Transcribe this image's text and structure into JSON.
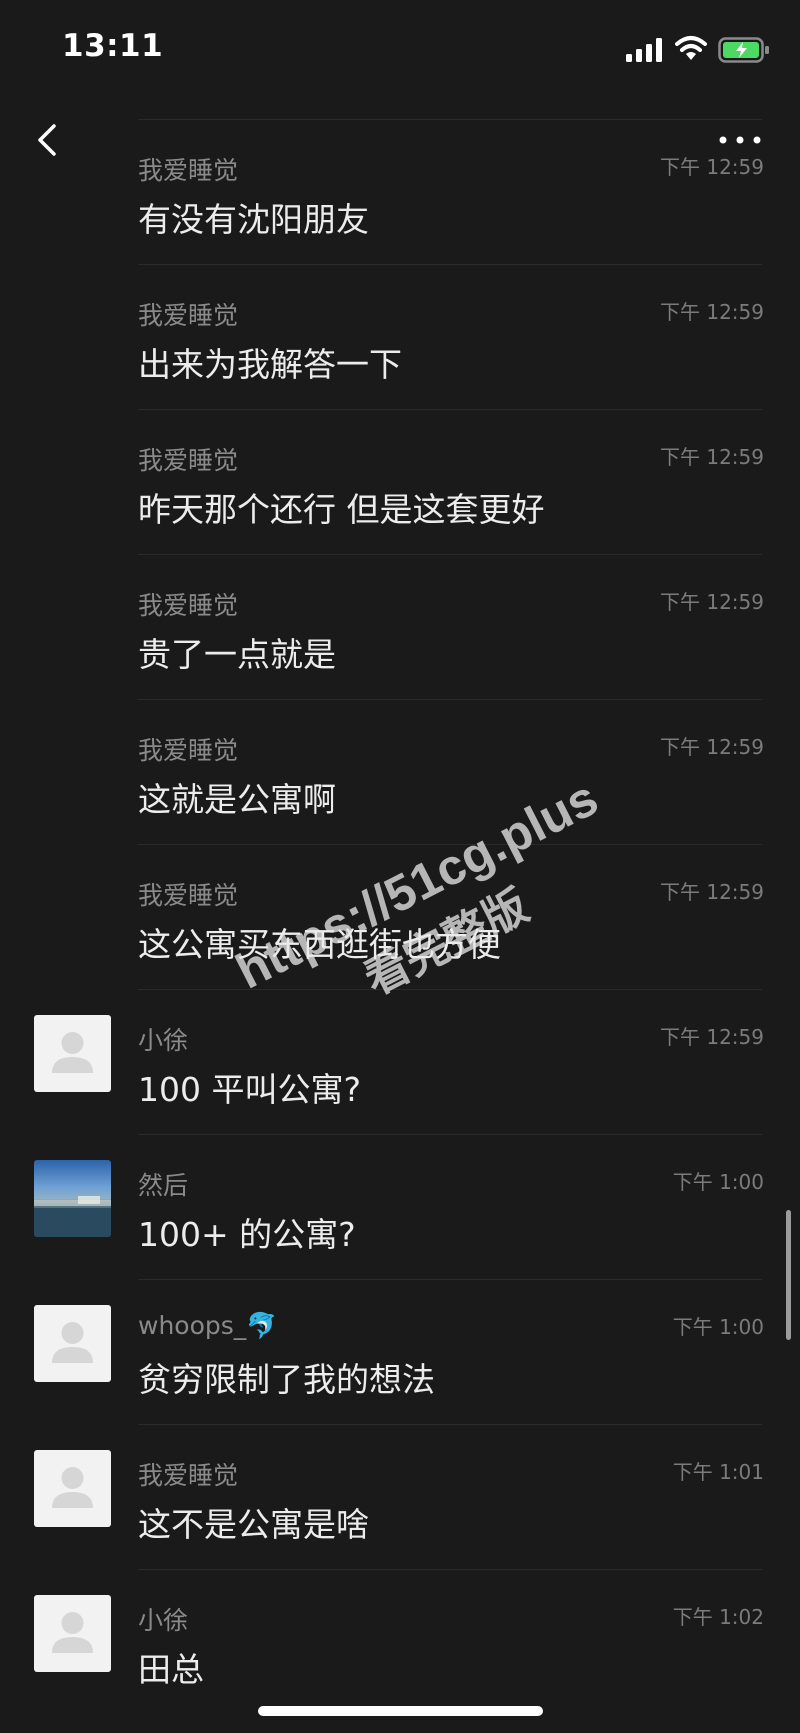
{
  "status_bar": {
    "time": "13:11"
  },
  "messages": [
    {
      "sender": "我爱睡觉",
      "time": "下午 12:59",
      "text": "有没有沈阳朋友",
      "avatar": "none"
    },
    {
      "sender": "我爱睡觉",
      "time": "下午 12:59",
      "text": "出来为我解答一下",
      "avatar": "none"
    },
    {
      "sender": "我爱睡觉",
      "time": "下午 12:59",
      "text": "昨天那个还行 但是这套更好",
      "avatar": "none"
    },
    {
      "sender": "我爱睡觉",
      "time": "下午 12:59",
      "text": "贵了一点就是",
      "avatar": "none"
    },
    {
      "sender": "我爱睡觉",
      "time": "下午 12:59",
      "text": "这就是公寓啊",
      "avatar": "none"
    },
    {
      "sender": "我爱睡觉",
      "time": "下午 12:59",
      "text": "这公寓买东西逛街也方便",
      "avatar": "none"
    },
    {
      "sender": "小徐",
      "time": "下午 12:59",
      "text": "100 平叫公寓?",
      "avatar": "default-avatar"
    },
    {
      "sender": "然后",
      "time": "下午 1:00",
      "text": "100+ 的公寓?",
      "avatar": "photo-avatar"
    },
    {
      "sender": "whoops_🐬",
      "time": "下午 1:00",
      "text": "贫穷限制了我的想法",
      "avatar": "default-avatar"
    },
    {
      "sender": "我爱睡觉",
      "time": "下午 1:01",
      "text": "这不是公寓是啥",
      "avatar": "default-avatar"
    },
    {
      "sender": "小徐",
      "time": "下午 1:02",
      "text": "田总",
      "avatar": "default-avatar"
    }
  ],
  "watermark": {
    "line1": "https://51cg.plus",
    "line2": "看完整版"
  },
  "icons": {
    "back": "chevron-left-icon",
    "more": "ellipsis-icon",
    "signal": "cellular-signal-icon",
    "wifi": "wifi-icon",
    "battery": "battery-charging-icon",
    "avatar_placeholder": "user-silhouette-icon"
  },
  "colors": {
    "background": "#1a1a1a",
    "battery_fill": "#4cd964"
  }
}
